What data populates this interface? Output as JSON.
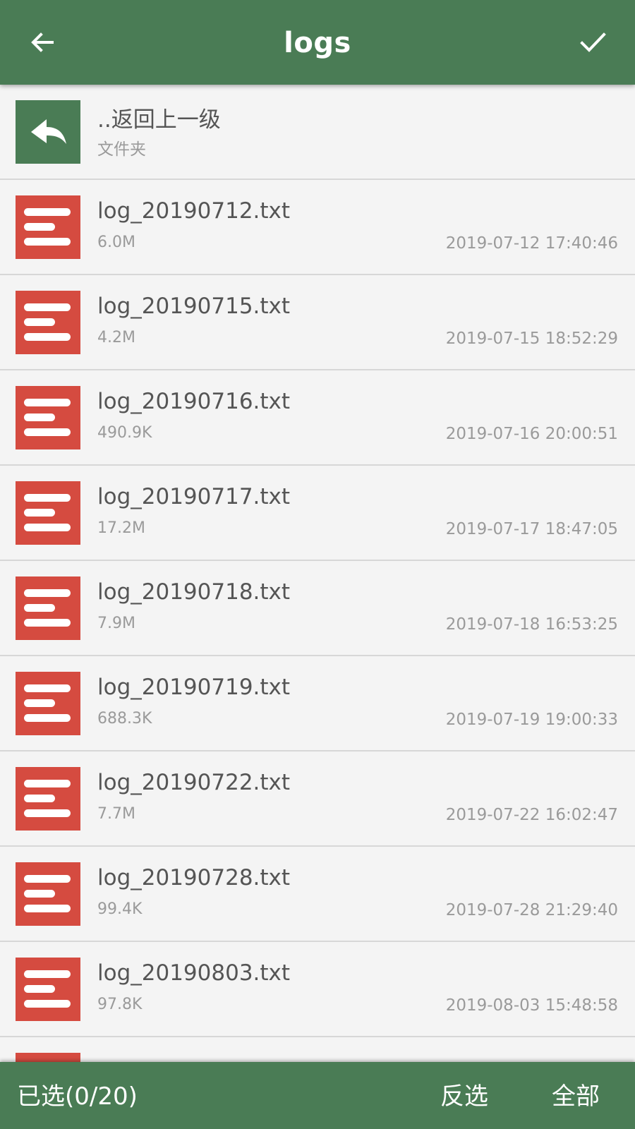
{
  "header": {
    "title": "logs",
    "back_icon": "arrow-left-icon",
    "confirm_icon": "checkmark-icon"
  },
  "colors": {
    "primary": "#4a7c55",
    "file_icon": "#d54b40",
    "background": "#f4f4f4"
  },
  "parent_entry": {
    "name": "..返回上一级",
    "type": "文件夹",
    "icon": "reply-arrow-icon"
  },
  "files": [
    {
      "name": "log_20190712.txt",
      "size": "6.0M",
      "date": "2019-07-12 17:40:46"
    },
    {
      "name": "log_20190715.txt",
      "size": "4.2M",
      "date": "2019-07-15 18:52:29"
    },
    {
      "name": "log_20190716.txt",
      "size": "490.9K",
      "date": "2019-07-16 20:00:51"
    },
    {
      "name": "log_20190717.txt",
      "size": "17.2M",
      "date": "2019-07-17 18:47:05"
    },
    {
      "name": "log_20190718.txt",
      "size": "7.9M",
      "date": "2019-07-18 16:53:25"
    },
    {
      "name": "log_20190719.txt",
      "size": "688.3K",
      "date": "2019-07-19 19:00:33"
    },
    {
      "name": "log_20190722.txt",
      "size": "7.7M",
      "date": "2019-07-22 16:02:47"
    },
    {
      "name": "log_20190728.txt",
      "size": "99.4K",
      "date": "2019-07-28 21:29:40"
    },
    {
      "name": "log_20190803.txt",
      "size": "97.8K",
      "date": "2019-08-03 15:48:58"
    }
  ],
  "footer": {
    "selected_label": "已选(0/20)",
    "invert_label": "反选",
    "all_label": "全部"
  }
}
